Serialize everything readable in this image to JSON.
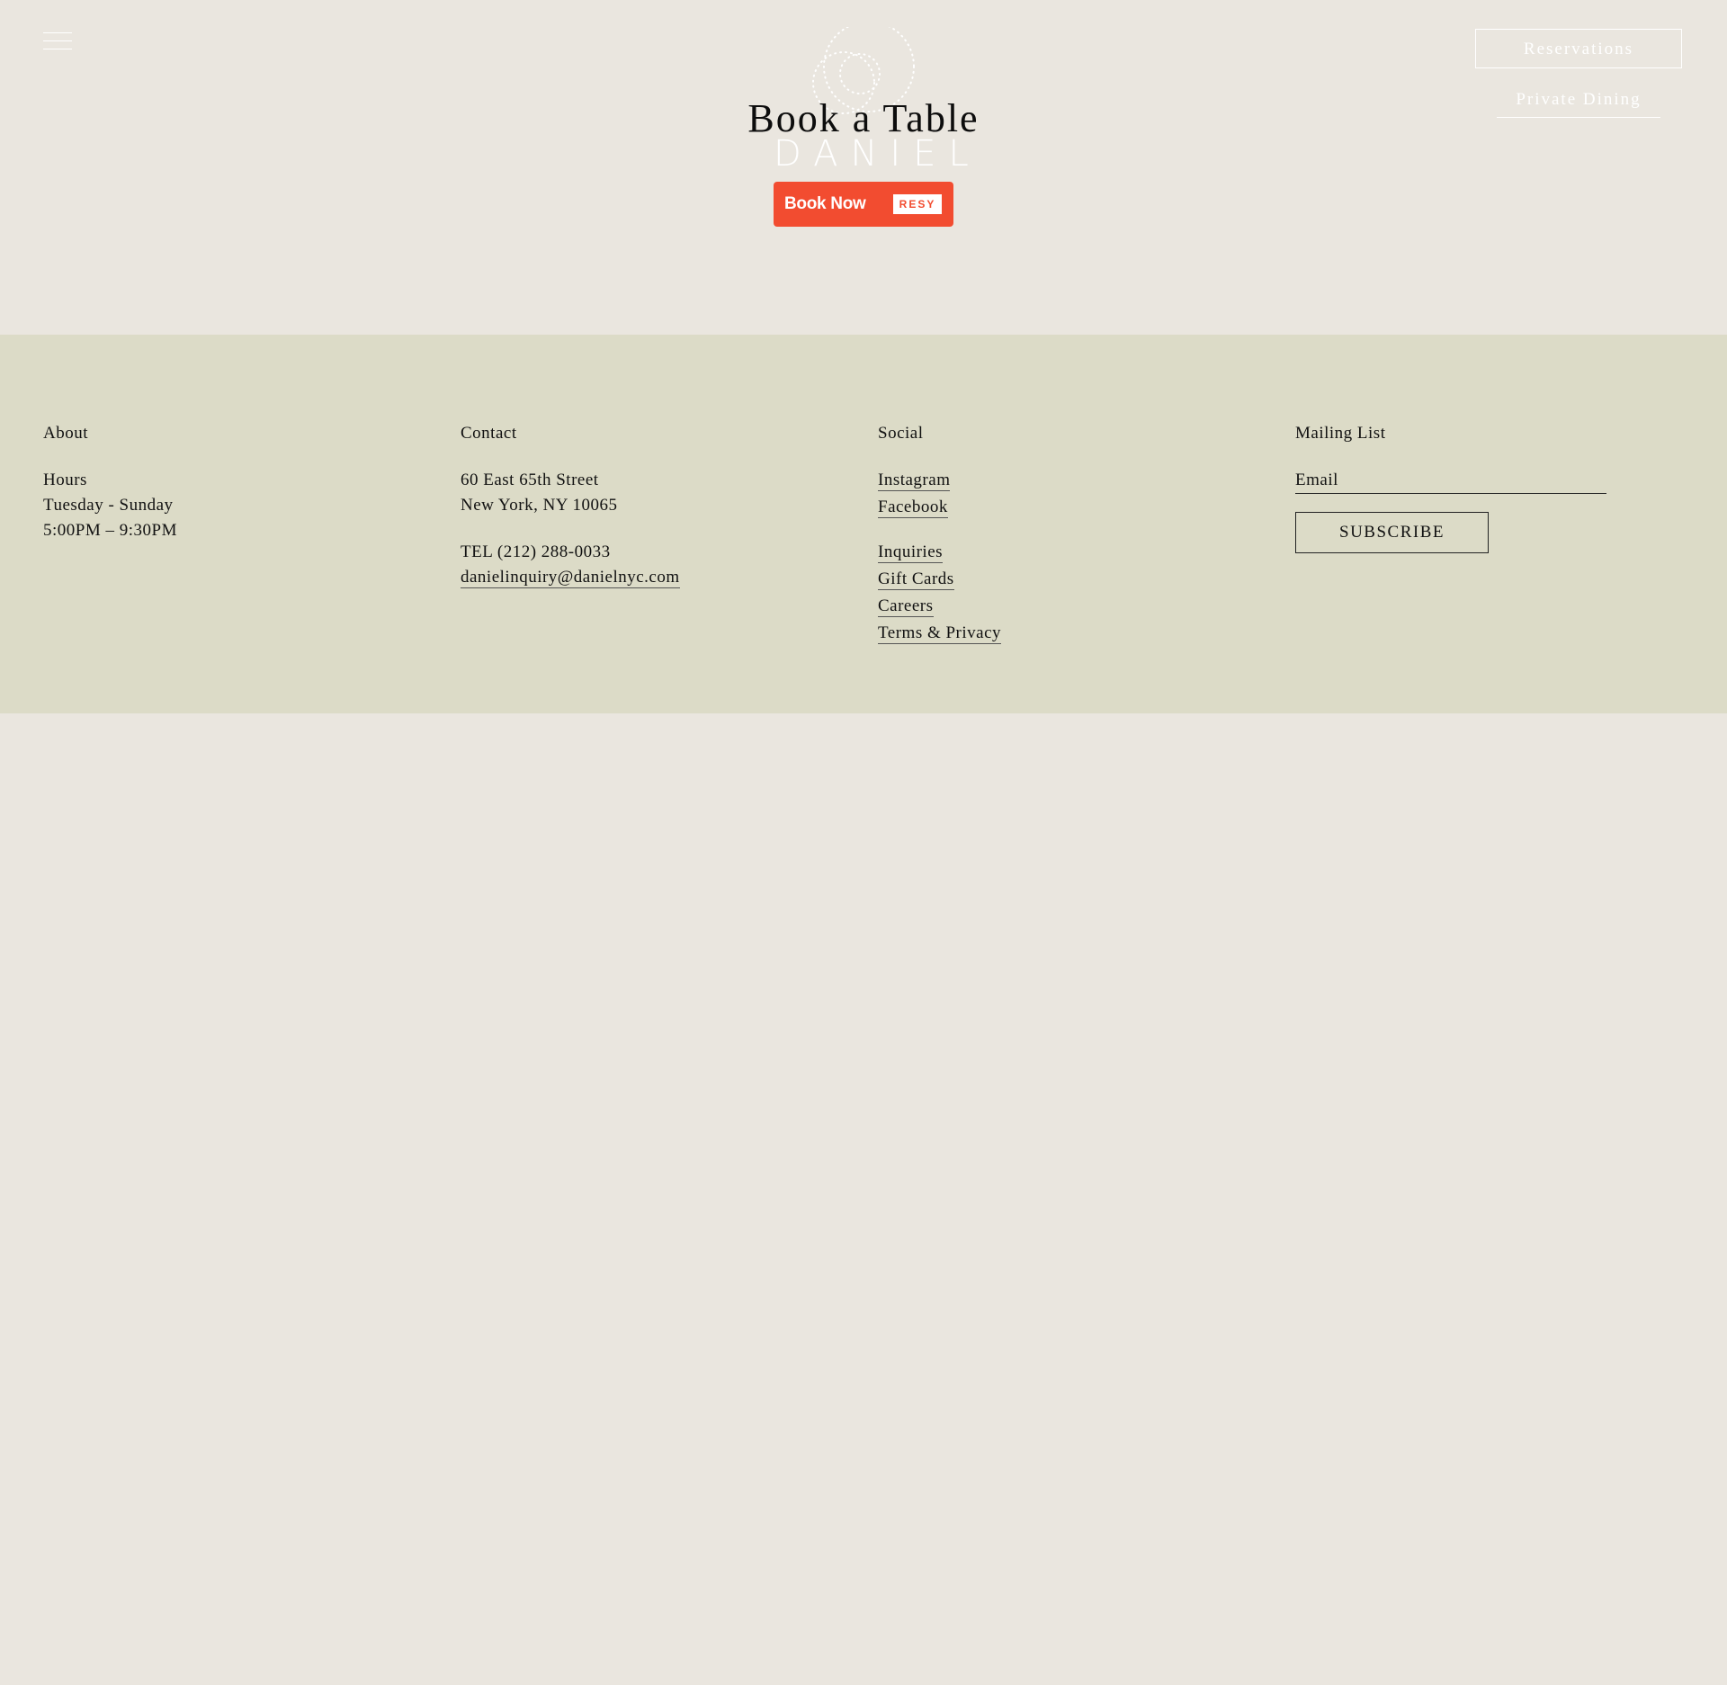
{
  "header": {
    "logo_text": "DANIEL",
    "page_title": "Book a Table",
    "book_now_label": "Book Now",
    "resy_label": "RESY",
    "reservations_label": "Reservations",
    "private_dining_label": "Private Dining"
  },
  "footer": {
    "about": {
      "title": "About",
      "hours_label": "Hours",
      "days": "Tuesday - Sunday",
      "times": "5:00PM – 9:30PM"
    },
    "contact": {
      "title": "Contact",
      "address_line1": "60 East 65th Street",
      "address_line2": "New York, NY 10065",
      "phone": "TEL (212) 288-0033",
      "email": "danielinquiry@danielnyc.com"
    },
    "social": {
      "title": "Social",
      "links": [
        "Instagram",
        "Facebook"
      ],
      "secondary_links": [
        "Inquiries",
        "Gift Cards",
        "Careers",
        "Terms & Privacy"
      ]
    },
    "mailing": {
      "title": "Mailing List",
      "email_placeholder": "Email",
      "subscribe_label": "SUBSCRIBE"
    }
  },
  "colors": {
    "page_bg": "#eae6df",
    "footer_bg": "#dcdbc7",
    "resy_red": "#f24c30",
    "text": "#111111",
    "header_text": "#ffffff"
  },
  "icons": {
    "menu": "hamburger-menu-icon",
    "logo": "daniel-logo-dotted-circles"
  }
}
